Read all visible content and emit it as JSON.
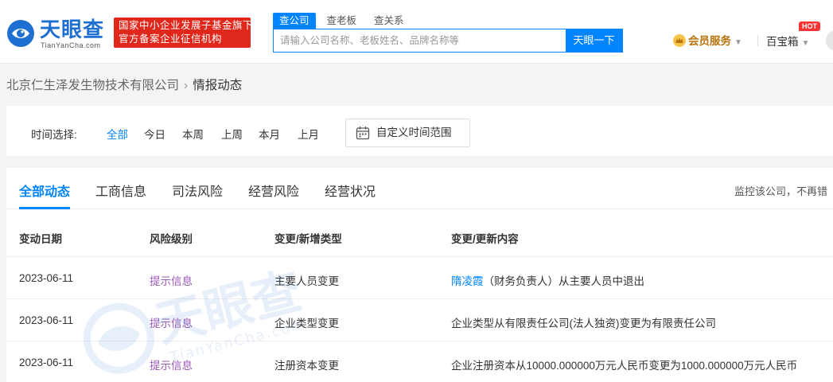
{
  "header": {
    "logo_text": "天眼查",
    "logo_sub": "TianYanCha.com",
    "banner_line1": "国家中小企业发展子基金旗下",
    "banner_line2": "官方备案企业征信机构",
    "search_tabs": [
      "查公司",
      "查老板",
      "查关系"
    ],
    "search_placeholder": "请输入公司名称、老板姓名、品牌名称等",
    "search_button": "天眼一下",
    "vip_label": "会员服务",
    "box_label": "百宝箱",
    "hot_badge": "HOT"
  },
  "breadcrumb": {
    "company": "北京仁生泽发生物技术有限公司",
    "current": "情报动态"
  },
  "filter": {
    "label": "时间选择:",
    "options": [
      "全部",
      "今日",
      "本周",
      "上周",
      "本月",
      "上月"
    ],
    "selected": "全部",
    "custom_range": "自定义时间范围"
  },
  "tabs": [
    "全部动态",
    "工商信息",
    "司法风险",
    "经营风险",
    "经营状况"
  ],
  "active_tab": "全部动态",
  "monitor_text": "监控该公司，不再错",
  "table": {
    "headers": [
      "变动日期",
      "风险级别",
      "变更/新增类型",
      "变更/更新内容"
    ],
    "rows": [
      {
        "date": "2023-06-11",
        "risk": "提示信息",
        "type": "主要人员变更",
        "content_link": "隋凌霞",
        "content_rest": "（财务负责人）从主要人员中退出"
      },
      {
        "date": "2023-06-11",
        "risk": "提示信息",
        "type": "企业类型变更",
        "content_link": "",
        "content_rest": "企业类型从有限责任公司(法人独资)变更为有限责任公司"
      },
      {
        "date": "2023-06-11",
        "risk": "提示信息",
        "type": "注册资本变更",
        "content_link": "",
        "content_rest": "企业注册资本从10000.000000万元人民币变更为1000.000000万元人民币"
      }
    ]
  },
  "watermark": {
    "main": "天眼查",
    "sub": "TianYanCha.com"
  },
  "colors": {
    "brand_blue": "#0084ff",
    "banner_red": "#e0271b",
    "risk_purple": "#9b59b6",
    "vip_gold": "#b8740c"
  }
}
